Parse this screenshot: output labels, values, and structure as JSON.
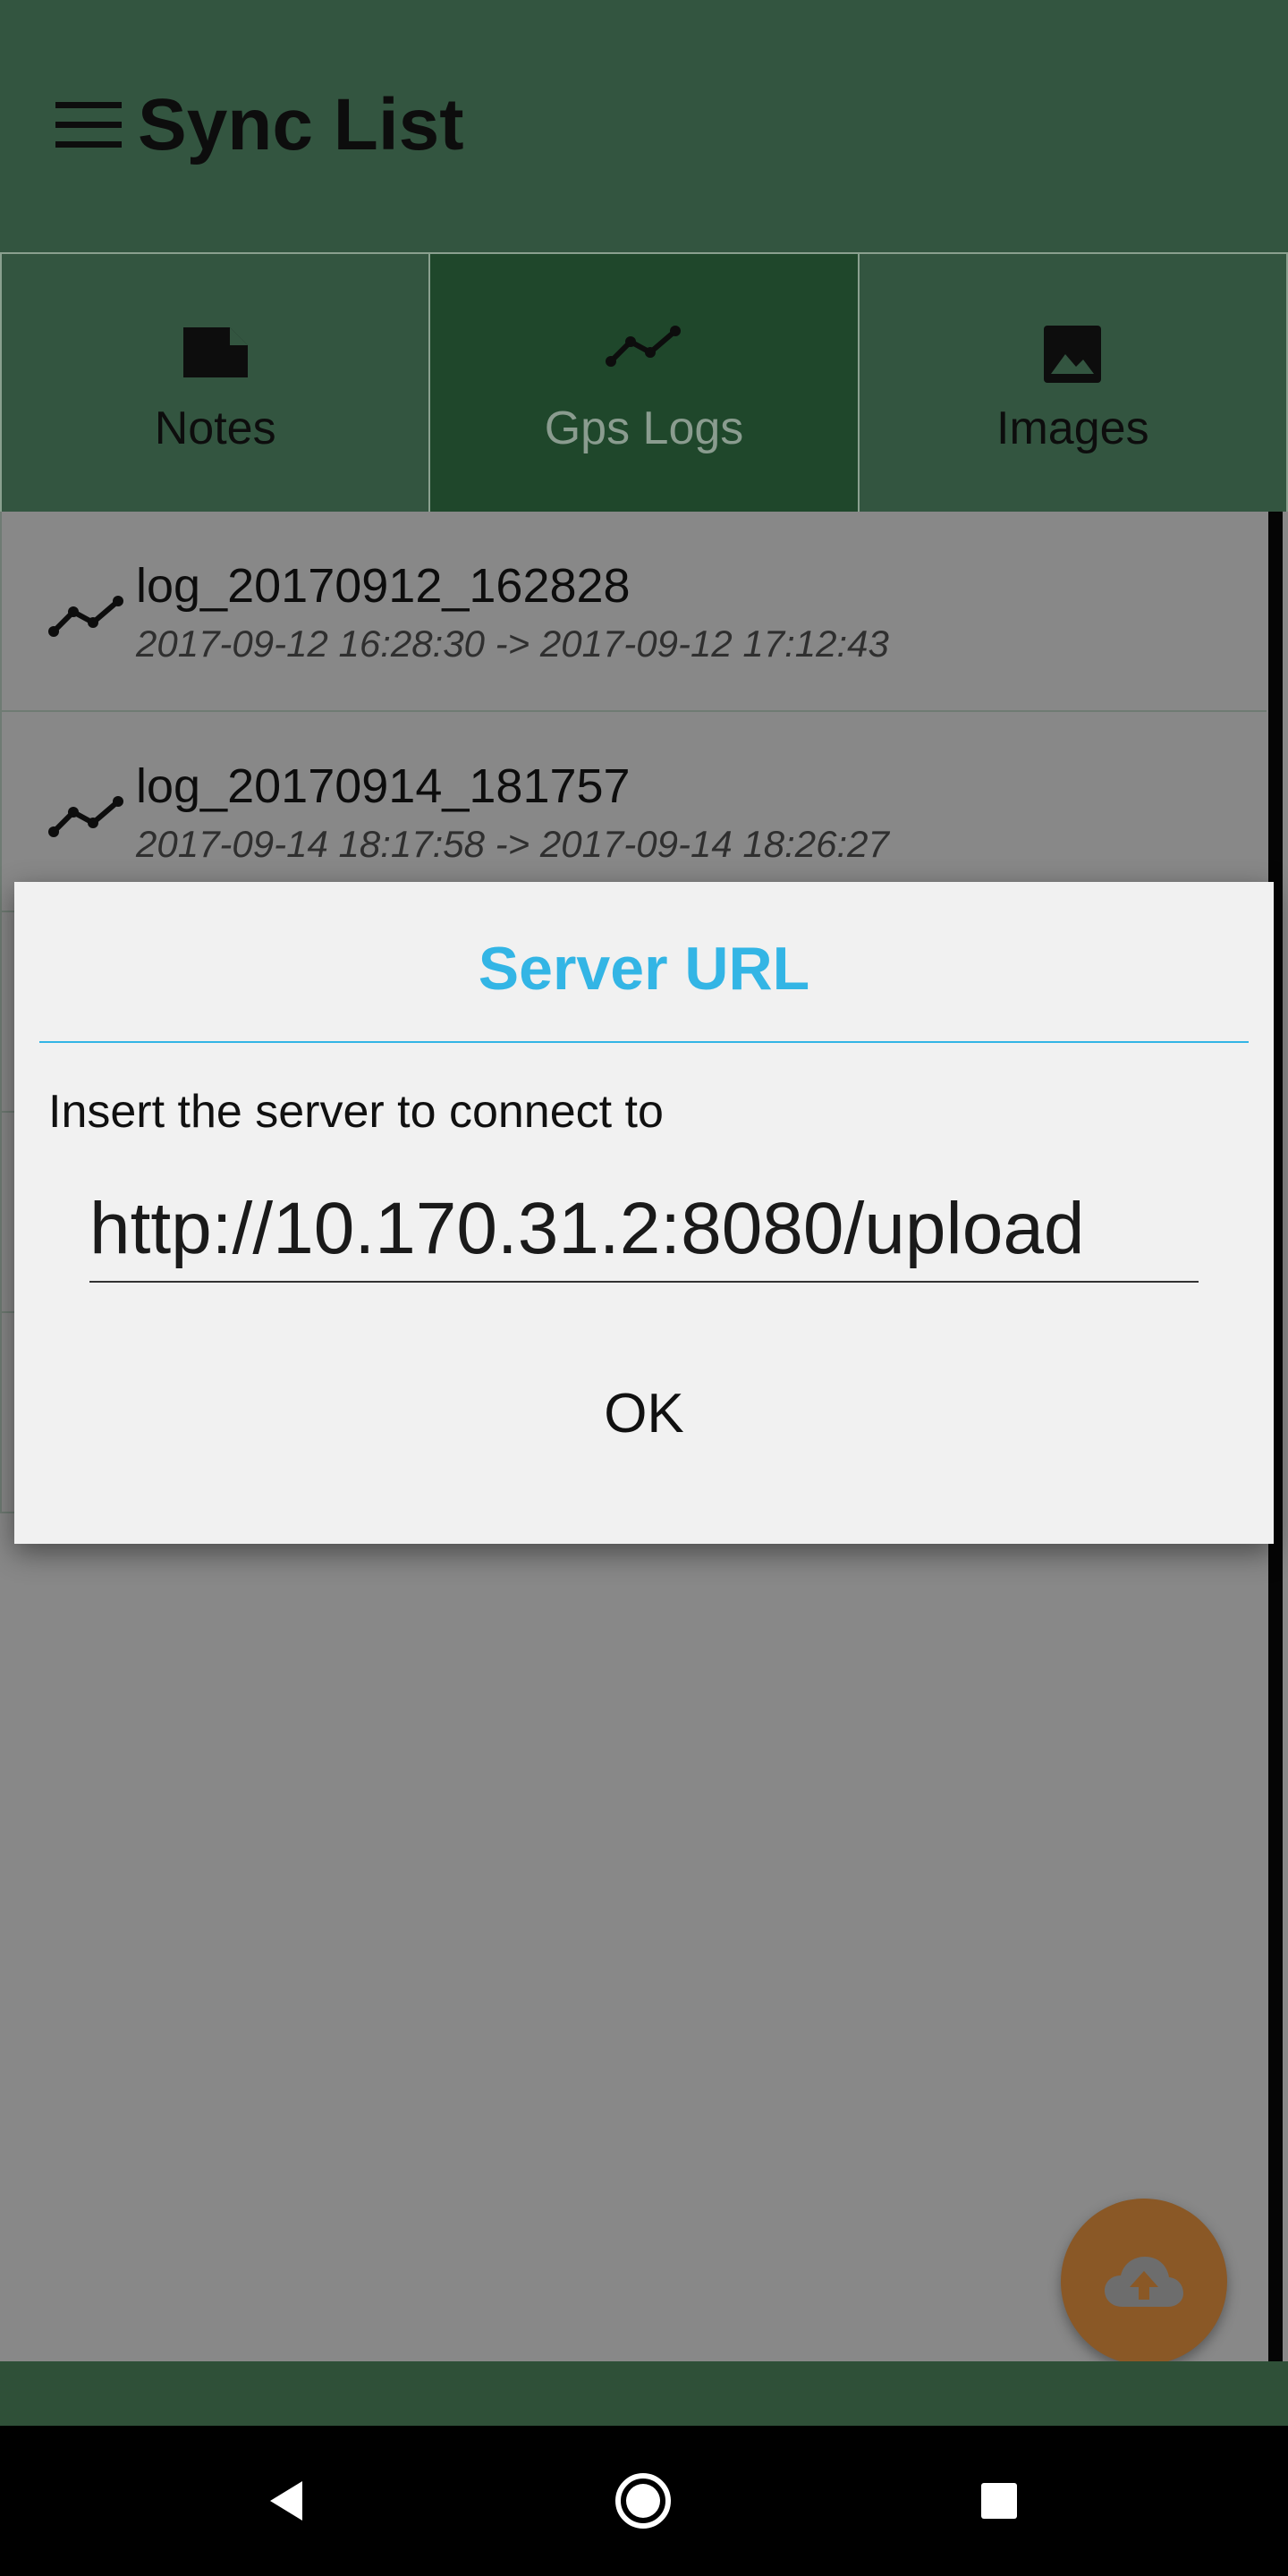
{
  "app": {
    "title": "Sync List",
    "accent": "#335540"
  },
  "tabs": [
    {
      "label": "Notes",
      "icon": "note-icon",
      "active": false
    },
    {
      "label": "Gps Logs",
      "icon": "gps-log-icon",
      "active": true
    },
    {
      "label": "Images",
      "icon": "image-icon",
      "active": false
    }
  ],
  "logs": [
    {
      "name": "log_20170912_162828",
      "range": "2017-09-12 16:28:30  ->  2017-09-12 17:12:43"
    },
    {
      "name": "log_20170914_181757",
      "range": "2017-09-14 18:17:58  ->  2017-09-14 18:26:27"
    }
  ],
  "dialog": {
    "title": "Server URL",
    "message": "Insert the server to connect to",
    "url_value": "http://10.170.31.2:8080/upload",
    "ok_label": "OK",
    "title_color": "#33b5e5"
  },
  "fab": {
    "icon": "cloud-upload-icon",
    "color": "#8a5826"
  },
  "navigation": {
    "back": "back-icon",
    "home": "home-icon",
    "recents": "recents-icon"
  }
}
